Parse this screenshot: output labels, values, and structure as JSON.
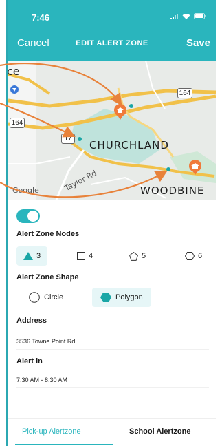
{
  "status_bar": {
    "time": "7:46"
  },
  "nav": {
    "cancel": "Cancel",
    "title": "EDIT ALERT ZONE",
    "save": "Save"
  },
  "map": {
    "labels": {
      "ce": "ce",
      "churchland": "CHURCHLAND",
      "woodbine": "WOODBINE",
      "taylor_rd": "Taylor Rd",
      "google": "Google"
    },
    "shields": {
      "route_164_a": "164",
      "route_164_b": "164",
      "route_17": "17"
    }
  },
  "form": {
    "toggle_on": true,
    "nodes_label": "Alert Zone Nodes",
    "nodes": [
      {
        "value": "3",
        "icon": "triangle-icon",
        "selected": true
      },
      {
        "value": "4",
        "icon": "square-icon",
        "selected": false
      },
      {
        "value": "5",
        "icon": "pentagon-icon",
        "selected": false
      },
      {
        "value": "6",
        "icon": "hexagon-icon",
        "selected": false
      }
    ],
    "shape_label": "Alert Zone Shape",
    "shapes": [
      {
        "label": "Circle",
        "icon": "circle-icon",
        "selected": false
      },
      {
        "label": "Polygon",
        "icon": "hexagon-icon",
        "selected": true
      }
    ],
    "address_label": "Address",
    "address_value": "3536 Towne Point Rd",
    "alert_in_label": "Alert in",
    "alert_in_value": "7:30 AM - 8:30 AM"
  },
  "tabs": [
    {
      "label": "Pick-up Alertzone",
      "active": true
    },
    {
      "label": "School Alertzone",
      "active": false
    }
  ],
  "colors": {
    "accent": "#2ab5bd",
    "annotation": "#e8823a",
    "map_marker": "#f07a3a"
  }
}
